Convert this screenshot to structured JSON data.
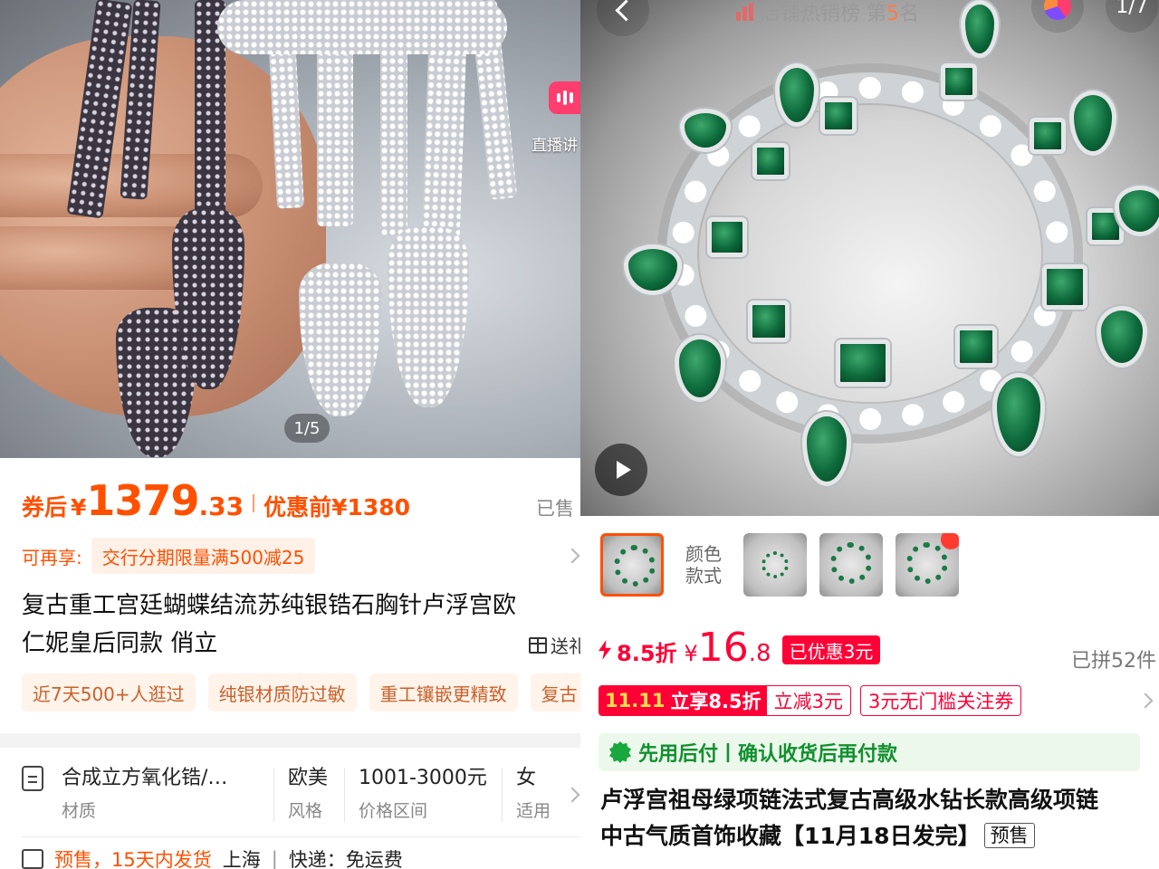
{
  "left": {
    "gallery": {
      "counter": "1/5",
      "live_label": "直播讲"
    },
    "price": {
      "coupon_label": "券后",
      "currency": "¥",
      "integer": "1379",
      "decimal": ".33",
      "before_label": "优惠前¥1380",
      "sold": "已售"
    },
    "promo": {
      "label": "可再享:",
      "tag": "交行分期限量满500减25"
    },
    "title": {
      "line1": "复古重工宫廷蝴蝶结流苏纯银锆石胸针卢浮宫欧",
      "line2": "仁妮皇后同款 俏立"
    },
    "gift_label": "送礼",
    "tags": [
      "近7天500+人逛过",
      "纯银材质防过敏",
      "重工镶嵌更精致",
      "复古"
    ],
    "attributes": [
      {
        "value": "合成立方氧化锆/…",
        "key": "材质"
      },
      {
        "value": "欧美",
        "key": "风格"
      },
      {
        "value": "1001-3000元",
        "key": "价格区间"
      },
      {
        "value": "女",
        "key": "适用"
      }
    ],
    "shipping": {
      "presale": "预售，15天内发货",
      "location": "上海",
      "express": "快递：免运费"
    }
  },
  "right": {
    "top_bar": {
      "rank_prefix": "店铺热销榜 第",
      "rank_num": "5",
      "rank_suffix": "名",
      "counter": "1/7"
    },
    "thumb_label": "颜色\n款式",
    "price": {
      "discount": "8.5折",
      "currency": "¥",
      "integer": "16",
      "decimal": ".8",
      "saved": "已优惠3元",
      "sold": "已拼52件"
    },
    "promo": {
      "event": "11.11",
      "event_text": "立享8.5折",
      "reduce": "立减3元",
      "coupon": "3元无门槛关注券"
    },
    "bnpl": "先用后付丨确认收货后再付款",
    "title": {
      "line1": "卢浮宫祖母绿项链法式复古高级水钻长款高级项链",
      "line2": "中古气质首饰收藏【11月18日发完】",
      "badge": "预售"
    }
  },
  "colors": {
    "taobao_orange": "#ff5000",
    "pdd_red": "#ff0036",
    "green": "#12902f"
  }
}
